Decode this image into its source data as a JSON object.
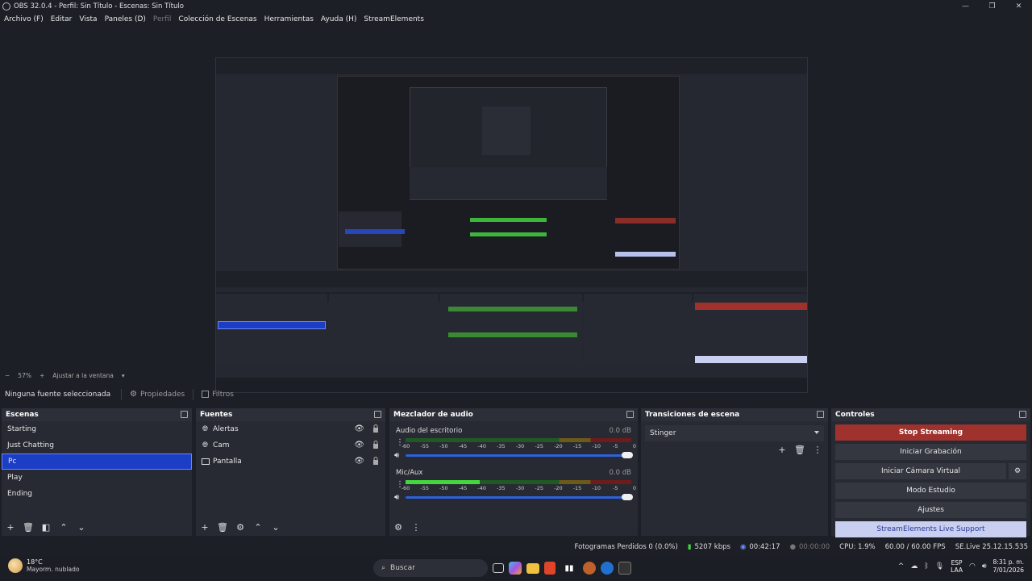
{
  "window": {
    "title": "OBS 32.0.4 - Perfil: Sin Título - Escenas: Sin Título"
  },
  "menu": [
    {
      "label": "Archivo (F)",
      "dim": false
    },
    {
      "label": "Editar",
      "dim": false
    },
    {
      "label": "Vista",
      "dim": false
    },
    {
      "label": "Paneles (D)",
      "dim": false
    },
    {
      "label": "Perfil",
      "dim": true
    },
    {
      "label": "Colección de Escenas",
      "dim": false
    },
    {
      "label": "Herramientas",
      "dim": false
    },
    {
      "label": "Ayuda (H)",
      "dim": false
    },
    {
      "label": "StreamElements",
      "dim": false
    }
  ],
  "zoom": {
    "minus": "−",
    "value": "57%",
    "plus": "+",
    "fit": "Ajustar a la ventana"
  },
  "source_toolbar": {
    "no_selection": "Ninguna fuente seleccionada",
    "properties": "Propiedades",
    "filters": "Filtros"
  },
  "scenes": {
    "title": "Escenas",
    "items": [
      "Starting",
      "Just Chatting",
      "Pc",
      "Play",
      "Ending"
    ],
    "selected_index": 2
  },
  "sources": {
    "title": "Fuentes",
    "items": [
      {
        "label": "Alertas",
        "icon": "globe-icon"
      },
      {
        "label": "Cam",
        "icon": "globe-icon"
      },
      {
        "label": "Pantalla",
        "icon": "monitor-icon"
      }
    ]
  },
  "mixer": {
    "title": "Mezclador de audio",
    "channels": [
      {
        "name": "Audio del escritorio",
        "db": "0.0 dB",
        "level": 0.0,
        "volume": 1.0
      },
      {
        "name": "Mic/Aux",
        "db": "0.0 dB",
        "level": 0.33,
        "volume": 1.0
      }
    ],
    "ticks": [
      "-60",
      "-55",
      "-50",
      "-45",
      "-40",
      "-35",
      "-30",
      "-25",
      "-20",
      "-15",
      "-10",
      "-5",
      "0"
    ]
  },
  "transitions": {
    "title": "Transiciones de escena",
    "selected": "Stinger"
  },
  "controls": {
    "title": "Controles",
    "stop_streaming": "Stop Streaming",
    "start_recording": "Iniciar Grabación",
    "virtual_cam": "Iniciar Cámara Virtual",
    "studio_mode": "Modo Estudio",
    "settings": "Ajustes",
    "support": "StreamElements Live Support"
  },
  "status": {
    "dropped_frames": "Fotogramas Perdidos 0 (0.0%)",
    "bitrate": "5207 kbps",
    "stream_time": "00:42:17",
    "rec_time": "00:00:00",
    "cpu": "CPU: 1.9%",
    "fps": "60.00 / 60.00 FPS",
    "version": "SE.Live 25.12.15.535"
  },
  "taskbar": {
    "temp": "18°C",
    "weather": "Mayorm. nublado",
    "search": "Buscar",
    "lang_top": "ESP",
    "lang_bottom": "LAA",
    "time": "8:31 p. m.",
    "date": "7/01/2026"
  },
  "colors": {
    "accent_selected": "#1c3ec4",
    "stop_button": "#a0322d",
    "support_button": "#c9cff0",
    "meter_green": "#43d63e",
    "volume_track": "#2d62d8"
  }
}
